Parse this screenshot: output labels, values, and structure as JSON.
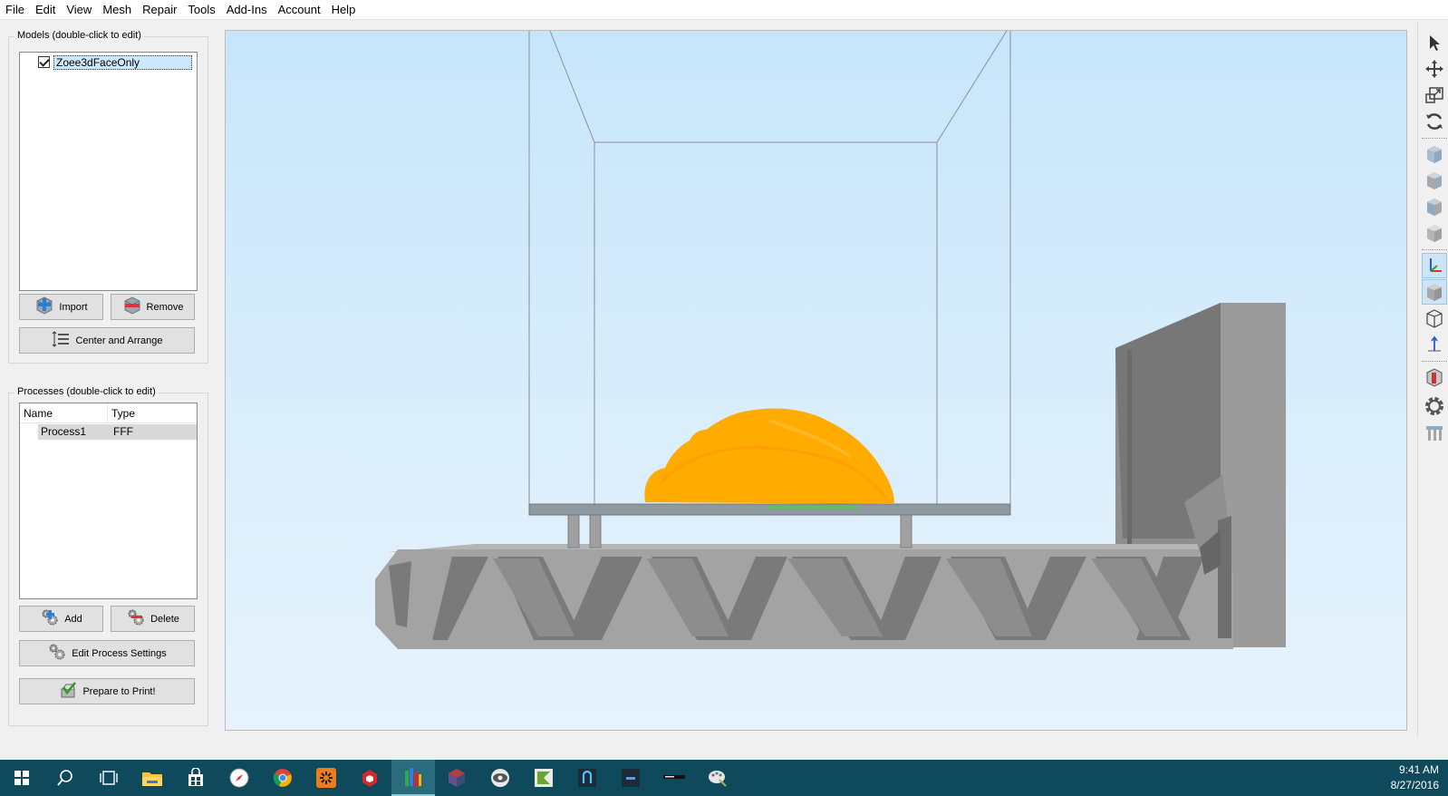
{
  "menubar": {
    "items": [
      "File",
      "Edit",
      "View",
      "Mesh",
      "Repair",
      "Tools",
      "Add-Ins",
      "Account",
      "Help"
    ]
  },
  "models_panel": {
    "title": "Models (double-click to edit)",
    "items": [
      {
        "name": "Zoee3dFaceOnly",
        "checked": true
      }
    ],
    "import_label": "Import",
    "remove_label": "Remove",
    "center_arrange_label": "Center and Arrange"
  },
  "processes_panel": {
    "title": "Processes (double-click to edit)",
    "columns": [
      "Name",
      "Type"
    ],
    "rows": [
      {
        "name": "Process1",
        "type": "FFF"
      }
    ],
    "add_label": "Add",
    "delete_label": "Delete",
    "edit_settings_label": "Edit Process Settings",
    "prepare_label": "Prepare to Print!"
  },
  "right_toolbar": {
    "tools": [
      "select-arrow-icon",
      "move-icon",
      "scale-icon",
      "rotate-icon",
      "front-view-icon",
      "back-view-icon",
      "left-view-icon",
      "right-view-icon",
      "axes-icon",
      "solid-view-icon",
      "wireframe-view-icon",
      "z-axis-icon",
      "section-view-icon",
      "settings-gear-icon",
      "supports-icon"
    ],
    "active": [
      "axes-icon",
      "solid-view-icon"
    ]
  },
  "viewport": {
    "model_color": "#ffab00",
    "machine_color": "#a8a8a8",
    "bed_color": "#8f9aa0"
  },
  "taskbar": {
    "apps": [
      "start-icon",
      "search-icon",
      "task-view-icon",
      "file-explorer-icon",
      "store-icon",
      "compass-app-icon",
      "chrome-icon",
      "orange-app-icon",
      "sketchup-icon",
      "simplify3d-icon",
      "red-cube-app-icon",
      "eye-app-icon",
      "green-app-icon",
      "n-app-icon",
      "dash-app-icon",
      "terminal-app-icon",
      "paint-app-icon"
    ],
    "time": "9:41 AM",
    "date": "8/27/2016"
  }
}
